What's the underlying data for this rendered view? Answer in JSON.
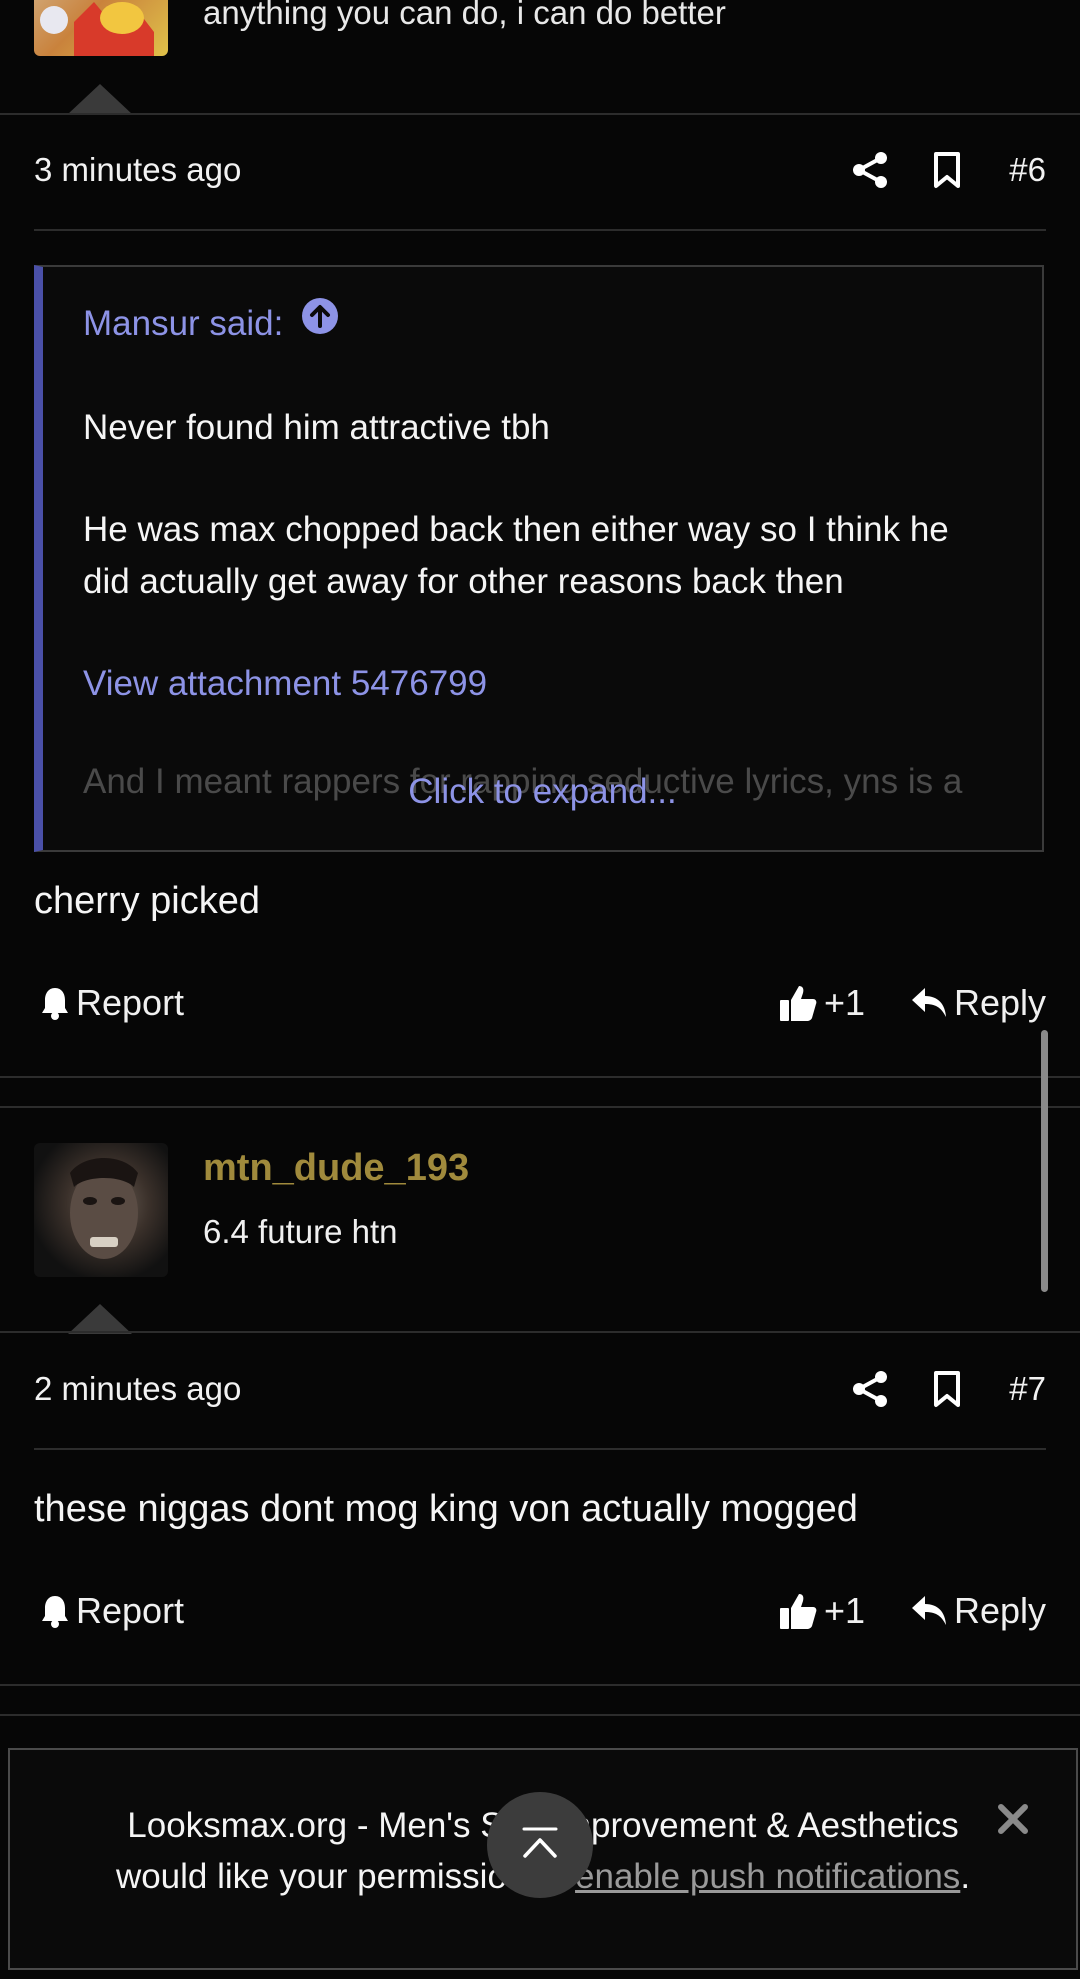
{
  "post_prev": {
    "signature": "anything you can do, i can do better",
    "time": "3 minutes ago",
    "number": "#6",
    "quote": {
      "author": "Mansur said:",
      "line1": "Never found him attractive tbh",
      "line2a": "He was max chopped back then either way so I think he",
      "line2b": "did actually get away for other reasons back then",
      "attachment": "View attachment 5476799",
      "faded": "And I meant rappers for rapping seductive lyrics, yns is a",
      "expand": "Click to expand..."
    },
    "body": "cherry picked",
    "report_label": "Report",
    "like_count": "+1",
    "reply_label": "Reply"
  },
  "post_next": {
    "username": "mtn_dude_193",
    "user_title": "6.4 future htn",
    "time": "2 minutes ago",
    "number": "#7",
    "body": "these niggas dont mog king von actually mogged",
    "report_label": "Report",
    "like_count": "+1",
    "reply_label": "Reply"
  },
  "notification_banner": {
    "line1": "Looksmax.org - Men's Self-Improvement & Aesthetics",
    "line2_prefix": "would like your permission to ",
    "line2_link": "enable push notifications",
    "line2_suffix": "."
  },
  "colors": {
    "background": "#060606",
    "username": "#a08a3c",
    "link": "#8d93e6",
    "quote_bar": "#4a50a8"
  },
  "icons": [
    "share-icon",
    "bookmark-icon",
    "arrow-up-circle-icon",
    "bell-icon",
    "thumbs-up-icon",
    "reply-icon",
    "close-icon",
    "scroll-top-icon"
  ]
}
